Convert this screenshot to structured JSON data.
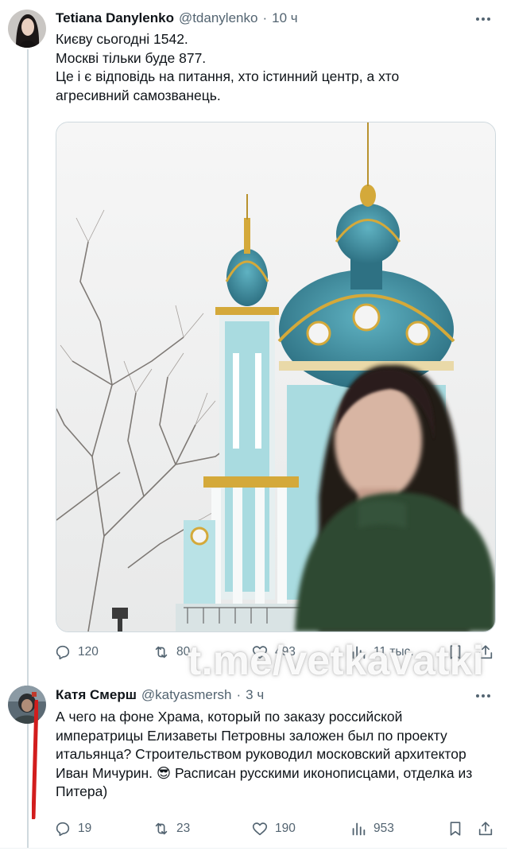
{
  "tweets": [
    {
      "name": "Tetiana Danylenko",
      "handle": "@tdanylenko",
      "separator": "·",
      "time": "10 ч",
      "lines": [
        "Києву сьогодні 1542.",
        "Москві тільки буде 877.",
        "Це і є відповідь на питання, хто істинний центр, а хто агресивний самозванець."
      ],
      "stats": {
        "replies": "120",
        "reposts": "80",
        "likes": "493",
        "views": "11 тыс."
      }
    },
    {
      "name": "Катя Смерш",
      "handle": "@katyasmersh",
      "separator": "·",
      "time": "3 ч",
      "text": "А чего на фоне Храма, который по заказу российской императрицы Елизаветы Петровны заложен был по проекту итальянца? Строительством руководил московский архитектор Иван Мичурин. 😎 Расписан русскими иконописцами, отделка из Питера)",
      "stats": {
        "replies": "19",
        "reposts": "23",
        "likes": "190",
        "views": "953"
      }
    }
  ],
  "watermark": "t.me/vetkavatki",
  "colors": {
    "text": "#0f1419",
    "muted": "#536471",
    "border": "#cfd9de",
    "dome_teal": "#3f8ea0",
    "gold": "#d4a93a",
    "sweater": "#2f4a33",
    "red_mark": "#d21d1d"
  },
  "icons": [
    "more-icon",
    "reply-icon",
    "repost-icon",
    "like-icon",
    "views-icon",
    "bookmark-icon",
    "share-icon"
  ]
}
